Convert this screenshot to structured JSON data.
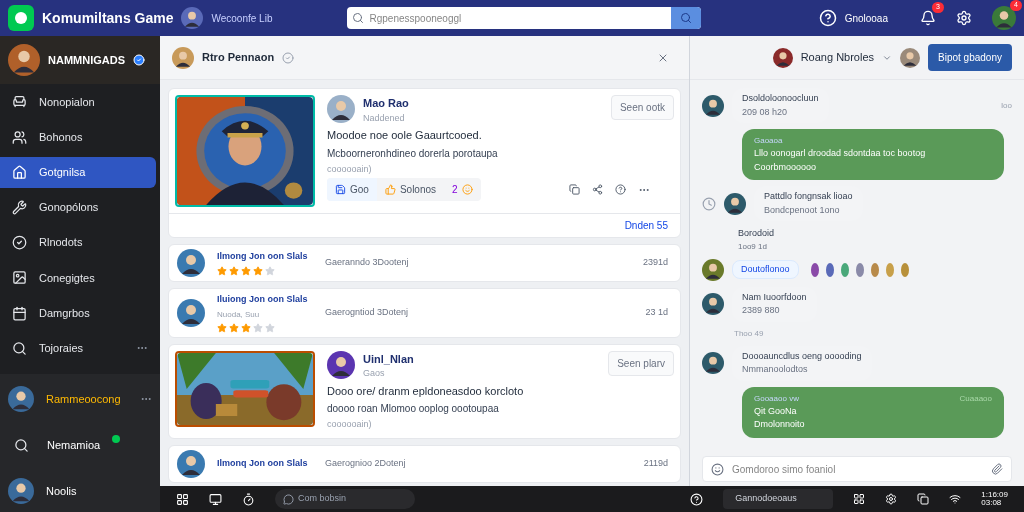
{
  "topbar": {
    "title": "Komumiltans Game",
    "channel": "Wecoonfe Lib",
    "search_placeholder": "Rgpenesspooneoggl",
    "status": "Gnolooaa",
    "badges": [
      "3",
      "4"
    ]
  },
  "sidebar": {
    "profile": {
      "name": "NAMMNIGADS",
      "verified": true
    },
    "items": [
      {
        "label": "Nonopialon",
        "selected": false
      },
      {
        "label": "Bohonos",
        "selected": false
      },
      {
        "label": "Gotgnilsa",
        "selected": true
      },
      {
        "label": "Gonopólons",
        "selected": false
      },
      {
        "label": "Rlnodots",
        "selected": false
      },
      {
        "label": "Conegigtes",
        "selected": false
      },
      {
        "label": "Damgrbos",
        "selected": false
      },
      {
        "label": "Tojoraies",
        "selected": false,
        "more": true
      }
    ],
    "users": [
      {
        "kind": "avatar",
        "label": "Rammeoocong",
        "more": true
      },
      {
        "kind": "search",
        "label": "Nemamioa",
        "online": true
      },
      {
        "kind": "avatar",
        "label": "Noolis"
      }
    ]
  },
  "feed": {
    "title": "Rtro Pennaon",
    "posts": [
      {
        "kind": "featured",
        "author": "Mao Rao",
        "subtitle": "Naddened",
        "button": "Seen ootk",
        "line1": "Moodoe noe oole Gaaurtcooed.",
        "line2": "Mcboorneronhdineo dorerla porotaupa",
        "meta": "coooooain)",
        "actions": [
          "Goo",
          "Solonos"
        ],
        "reaction_count": "2",
        "footer_link": "Dnden 55"
      },
      {
        "kind": "row",
        "title": "Ilmong Jon oon Slals",
        "note": "Gaeranndo 3Dootenj",
        "time": "2391d",
        "stars": 4
      },
      {
        "kind": "row",
        "title": "Iluiong Jon oon Slals",
        "subtitle": "Nuoda, Suu",
        "note": "Gaerogntiod 3Dotenj",
        "time": "23 1d",
        "stars": 3
      },
      {
        "kind": "featured",
        "author": "Uinl_Nlan",
        "subtitle": "Gaos",
        "button": "Seen plarv",
        "line1": "Dooo ore/ dranm epldoneasdoo korcloto",
        "line2": "doooo roan Mlomoo ooplog oootoupaa",
        "meta": "coooooain)"
      },
      {
        "kind": "row",
        "title": "Ilmonq Jon oon Slals",
        "note": "Gaerognioo 2Dotenj",
        "time": "2119d"
      }
    ]
  },
  "chat": {
    "user": "Roang Nbroles",
    "button": "Bipot gbadony",
    "messages": [
      {
        "kind": "in",
        "lines": [
          "Dsoldoloonoocluun",
          "209 08 h20"
        ],
        "side": "Ioo"
      },
      {
        "kind": "out",
        "label": "Gaoaoa",
        "lines": [
          "Lllo oonogarl droodad sdontdaa toc bootog",
          "Coorbmoooooo"
        ]
      },
      {
        "kind": "in",
        "lines": [
          "Pattdlo fongnsak lioao",
          "Bondcpenoot 1ono"
        ],
        "clock": true
      },
      {
        "kind": "note",
        "lines": [
          "Borodoid",
          "1oo9 1d"
        ]
      },
      {
        "kind": "chip",
        "lines": [
          "Doutoflonoo"
        ]
      },
      {
        "kind": "in",
        "lines": [
          "Nam Iuoorfdoon",
          "2389 880"
        ]
      },
      {
        "kind": "time",
        "lines": [
          "Thoo 49"
        ]
      },
      {
        "kind": "in",
        "lines": [
          "Doooauncdlus oeng ooooding",
          "Nmmanoolodtos"
        ]
      },
      {
        "kind": "out",
        "label": "Gooaaoo vw",
        "lines": [
          "Qit GooNa",
          "Dmolonnoito"
        ],
        "side": "Cuaaaoo"
      }
    ],
    "input_placeholder": "Gomdoroo simo foaniol"
  },
  "taskbar": {
    "search": "Com bobsin",
    "center": "Gannodoeoaus",
    "clock": [
      "1:16:09",
      "03:08"
    ]
  }
}
